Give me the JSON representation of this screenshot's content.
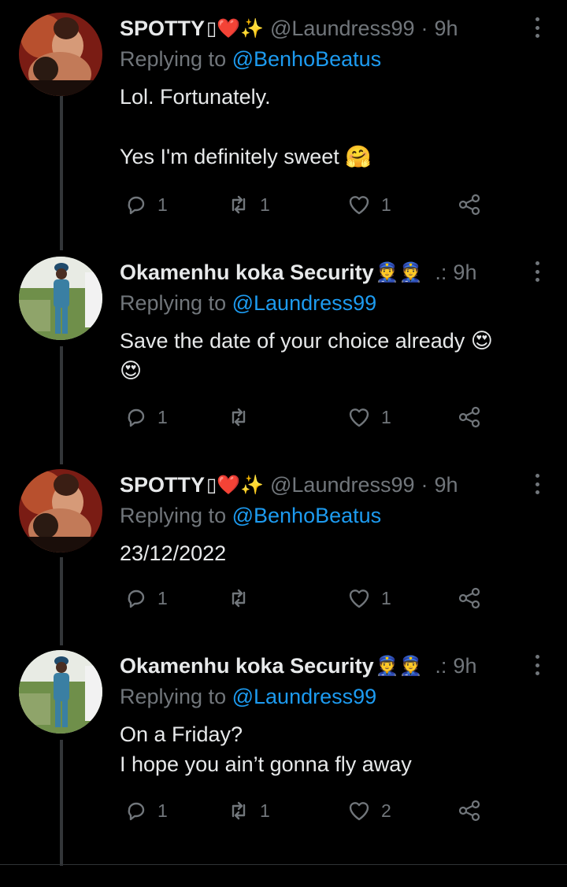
{
  "colors": {
    "background": "#000000",
    "text": "#e7e9ea",
    "muted": "#71767b",
    "link": "#1d9bf0",
    "thread_line": "#333639"
  },
  "tweets": [
    {
      "name": "SPOTTY",
      "name_emoji": "▯❤️✨",
      "handle": "@Laundress99",
      "dot": "·",
      "time": "9h",
      "replying_prefix": "Replying to",
      "replying_to": "@BenhoBeatus",
      "lines": [
        "Lol. Fortunately.",
        "",
        "Yes I'm definitely sweet 🤗"
      ],
      "reply_count": "1",
      "retweet_count": "1",
      "like_count": "1",
      "avatar_icon": "user-avatar-icon"
    },
    {
      "name": "Okamenhu koka Security",
      "name_emoji": "👮👮",
      "handle": "",
      "dot": ".:",
      "time": "9h",
      "replying_prefix": "Replying to",
      "replying_to": "@Laundress99",
      "lines": [
        "Save the date of your choice already 😍",
        "😍"
      ],
      "reply_count": "1",
      "retweet_count": "",
      "like_count": "1",
      "avatar_icon": "user-avatar-icon"
    },
    {
      "name": "SPOTTY",
      "name_emoji": "▯❤️✨",
      "handle": "@Laundress99",
      "dot": "·",
      "time": "9h",
      "replying_prefix": "Replying to",
      "replying_to": "@BenhoBeatus",
      "lines": [
        "23/12/2022"
      ],
      "reply_count": "1",
      "retweet_count": "",
      "like_count": "1",
      "avatar_icon": "user-avatar-icon"
    },
    {
      "name": "Okamenhu koka Security",
      "name_emoji": "👮👮",
      "handle": "",
      "dot": ".:",
      "time": "9h",
      "replying_prefix": "Replying to",
      "replying_to": "@Laundress99",
      "lines": [
        "On a Friday?",
        "I hope you ain’t gonna fly away"
      ],
      "reply_count": "1",
      "retweet_count": "1",
      "like_count": "2",
      "avatar_icon": "user-avatar-icon"
    }
  ]
}
